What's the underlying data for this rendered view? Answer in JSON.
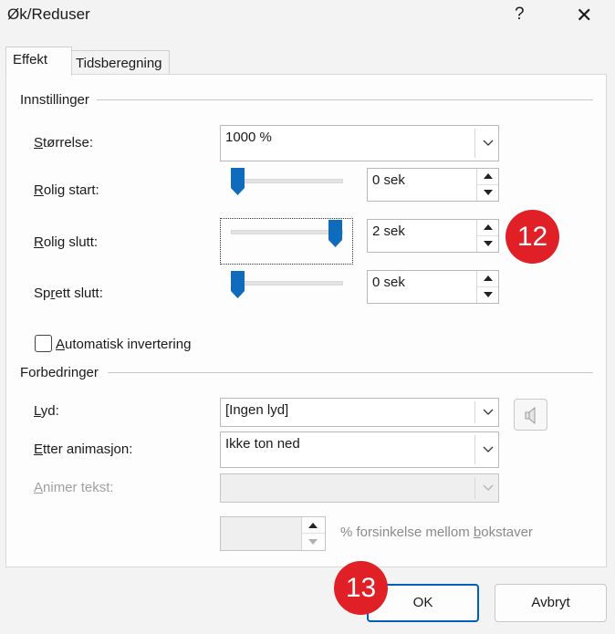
{
  "window": {
    "title": "Øk/Reduser",
    "help": "?",
    "close": "✕"
  },
  "tabs": [
    {
      "label": "Effekt"
    },
    {
      "label": "Tidsberegning"
    }
  ],
  "settings": {
    "group_label": "Innstillinger",
    "size": {
      "label": "Størrelse:",
      "value": "1000 %"
    },
    "smooth_start": {
      "label": "Rolig start:",
      "value": "0 sek",
      "slider_position": 0.0
    },
    "smooth_end": {
      "label": "Rolig slutt:",
      "value": "2 sek",
      "slider_position": 1.0
    },
    "bounce_end": {
      "label": "Sprett slutt:",
      "value": "0 sek",
      "slider_position": 0.0
    },
    "auto_reverse": {
      "label": "Automatisk invertering",
      "checked": false
    }
  },
  "enhancements": {
    "group_label": "Forbedringer",
    "sound": {
      "label": "Lyd:",
      "value": "[Ingen lyd]"
    },
    "after_animation": {
      "label": "Etter animasjon:",
      "value": "Ikke ton ned"
    },
    "animate_text": {
      "label": "Animer tekst:",
      "value": ""
    },
    "delay": {
      "value": "",
      "suffix": "% forsinkelse mellom bokstaver"
    }
  },
  "buttons": {
    "ok": "OK",
    "cancel": "Avbryt"
  },
  "badges": {
    "slider_step": "12",
    "ok_step": "13"
  },
  "colors": {
    "accent": "#005fb8",
    "slider_thumb": "#0f6cbd",
    "badge": "#e01f26"
  }
}
